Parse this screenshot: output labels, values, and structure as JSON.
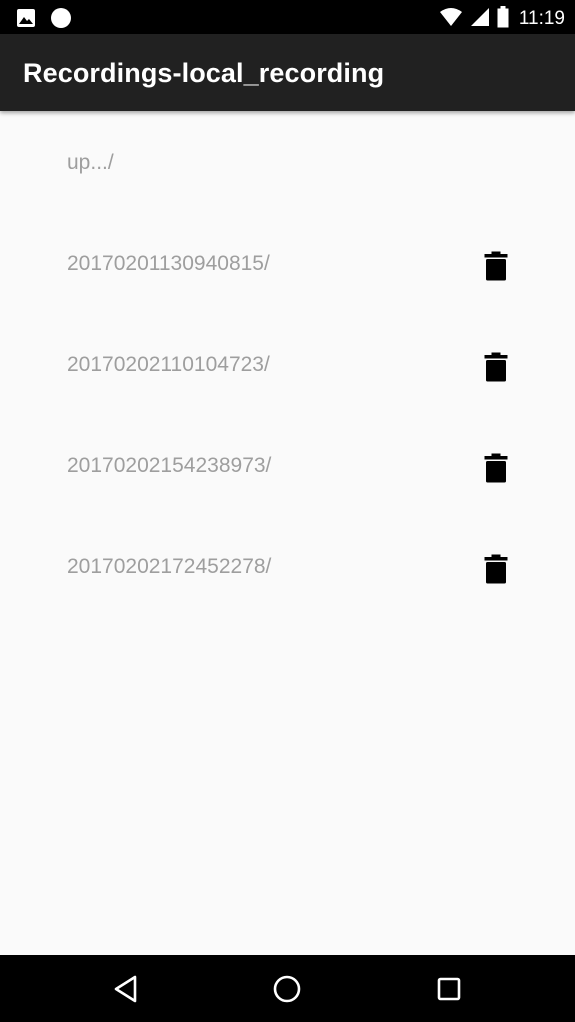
{
  "status_bar": {
    "time": "11:19",
    "left_icons": [
      "image-icon",
      "circle-notification-icon"
    ],
    "right_icons": [
      "wifi-icon",
      "cell-signal-icon",
      "battery-icon"
    ]
  },
  "app_bar": {
    "title": "Recordings-local_recording"
  },
  "list": {
    "up_label": "up.../",
    "items": [
      {
        "label": "20170201130940815/",
        "action_icon": "trash-icon"
      },
      {
        "label": "20170202110104723/",
        "action_icon": "trash-icon"
      },
      {
        "label": "20170202154238973/",
        "action_icon": "trash-icon"
      },
      {
        "label": "20170202172452278/",
        "action_icon": "trash-icon"
      }
    ]
  },
  "nav_bar": {
    "buttons": [
      "back-icon",
      "home-icon",
      "recents-icon"
    ]
  },
  "colors": {
    "status_bar": "#000000",
    "app_bar": "#212121",
    "background": "#fafafa",
    "item_text": "#9e9e9e",
    "icon": "#000000"
  }
}
